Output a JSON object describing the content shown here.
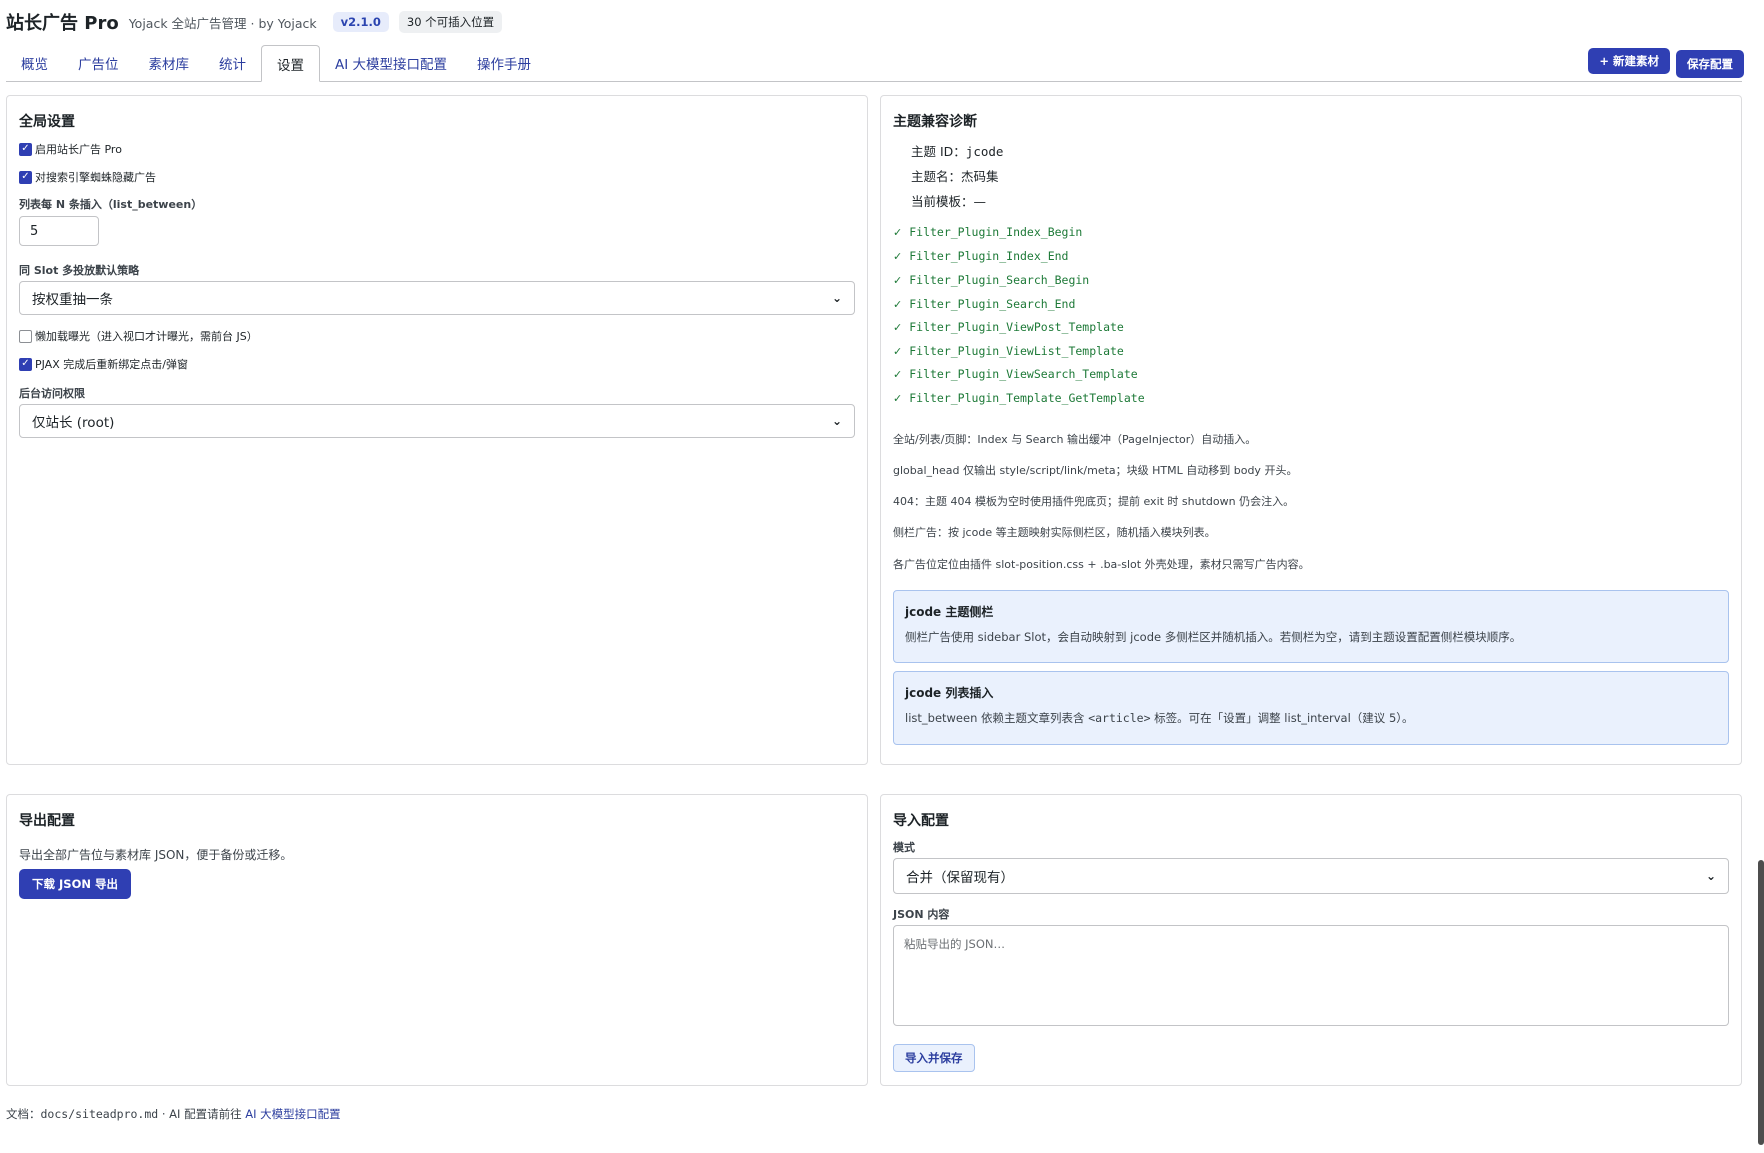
{
  "header": {
    "title": "站长广告 Pro",
    "subtitle": "Yojack 全站广告管理 · by Yojack",
    "version_badge": "v2.1.0",
    "count_badge": "30 个可插入位置"
  },
  "tabs": [
    {
      "label": "概览",
      "active": false
    },
    {
      "label": "广告位",
      "active": false
    },
    {
      "label": "素材库",
      "active": false
    },
    {
      "label": "统计",
      "active": false
    },
    {
      "label": "设置",
      "active": true
    },
    {
      "label": "AI 大模型接口配置",
      "active": false
    },
    {
      "label": "操作手册",
      "active": false
    }
  ],
  "actions": {
    "new_material": "+ 新建素材",
    "save_config": "保存配置"
  },
  "global_settings": {
    "title": "全局设置",
    "enable_plugin": {
      "label": "启用站长广告 Pro",
      "checked": true
    },
    "hide_for_spiders": {
      "label": "对搜索引擎蜘蛛隐藏广告",
      "checked": true
    },
    "list_between_label": "列表每 N 条插入（list_between）",
    "list_between_value": "5",
    "multi_slot_label": "同 Slot 多投放默认策略",
    "multi_slot_value": "按权重抽一条",
    "lazy_exposure": {
      "label": "懒加载曝光（进入视口才计曝光，需前台 JS）",
      "checked": false
    },
    "pjax_rebind": {
      "label": "PJAX 完成后重新绑定点击/弹窗",
      "checked": true
    },
    "access_label": "后台访问权限",
    "access_value": "仅站长 (root)"
  },
  "theme_diagnosis": {
    "title": "主题兼容诊断",
    "theme_id_label": "主题 ID：",
    "theme_id_value": "jcode",
    "theme_name_label": "主题名：",
    "theme_name_value": "杰码集",
    "current_template_label": "当前模板：",
    "current_template_value": "—",
    "hooks": [
      "Filter_Plugin_Index_Begin",
      "Filter_Plugin_Index_End",
      "Filter_Plugin_Search_Begin",
      "Filter_Plugin_Search_End",
      "Filter_Plugin_ViewPost_Template",
      "Filter_Plugin_ViewList_Template",
      "Filter_Plugin_ViewSearch_Template",
      "Filter_Plugin_Template_GetTemplate"
    ],
    "hook_status_icon": "check-icon",
    "notes": [
      "全站/列表/页脚：Index 与 Search 输出缓冲（PageInjector）自动插入。",
      "global_head 仅输出 style/script/link/meta；块级 HTML 自动移到 body 开头。",
      "404：主题 404 模板为空时使用插件兜底页；提前 exit 时 shutdown 仍会注入。",
      "侧栏广告：按 jcode 等主题映射实际侧栏区，随机插入模块列表。",
      "各广告位定位由插件 slot-position.css + .ba-slot 外壳处理，素材只需写广告内容。"
    ],
    "sidebar_notice": {
      "title": "jcode 主题侧栏",
      "text": "侧栏广告使用 sidebar Slot，会自动映射到 jcode 多侧栏区并随机插入。若侧栏为空，请到主题设置配置侧栏模块顺序。"
    },
    "list_notice": {
      "title": "jcode 列表插入",
      "text_before": "list_between 依赖主题文章列表含 ",
      "text_code": "<article>",
      "text_after": " 标签。可在「设置」调整 list_interval（建议 5）。"
    }
  },
  "export_config": {
    "title": "导出配置",
    "description": "导出全部广告位与素材库 JSON，便于备份或迁移。",
    "button": "下载 JSON 导出"
  },
  "import_config": {
    "title": "导入配置",
    "mode_label": "模式",
    "mode_value": "合并（保留现有）",
    "json_label": "JSON 内容",
    "json_placeholder": "粘贴导出的 JSON…",
    "button": "导入并保存"
  },
  "footer": {
    "prefix": "文档：",
    "doc_path": "docs/siteadpro.md",
    "middle": " · AI 配置请前往 ",
    "link": "AI 大模型接口配置"
  },
  "colors": {
    "accent": "#2f3fb3",
    "hook_ok": "#1e7a38",
    "notice_bg": "#eaf1fd"
  }
}
